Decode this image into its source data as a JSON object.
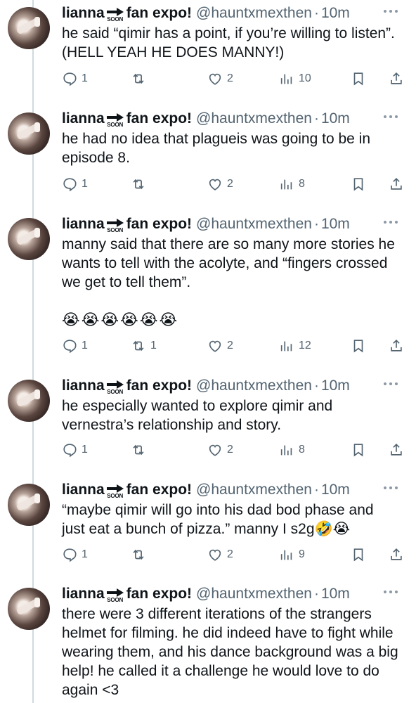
{
  "author": {
    "name": "lianna",
    "badge_text": "SOON",
    "display_suffix": "fan expo!",
    "handle": "@hauntxmexthen",
    "separator": "·",
    "time": "10m"
  },
  "tweets": [
    {
      "text": "he said “qimir has a point, if you’re willing to listen”. (HELL YEAH HE DOES MANNY!)",
      "emojis": "",
      "reply_count": "1",
      "retweet_count": "",
      "like_count": "2",
      "view_count": "10"
    },
    {
      "text": "he had no idea that plagueis was going to be in episode 8.",
      "emojis": "",
      "reply_count": "1",
      "retweet_count": "",
      "like_count": "2",
      "view_count": "8"
    },
    {
      "text": "manny said that there are so many more stories he wants to tell with the acolyte, and “fingers crossed we get to tell them”.",
      "emojis": "😭😭😭😭😭😭",
      "reply_count": "1",
      "retweet_count": "1",
      "like_count": "2",
      "view_count": "12"
    },
    {
      "text": "he especially wanted to explore qimir and vernestra’s relationship and story.",
      "emojis": "",
      "reply_count": "1",
      "retweet_count": "",
      "like_count": "2",
      "view_count": "8"
    },
    {
      "text": "“maybe qimir will go into his dad bod phase and just eat a bunch of pizza.” manny I s2g🤣😭",
      "emojis": "",
      "reply_count": "1",
      "retweet_count": "",
      "like_count": "2",
      "view_count": "9"
    },
    {
      "text": "there were 3 different iterations of the strangers helmet for filming. he did indeed have to fight while wearing them, and his dance background was a big help! he called it a challenge he would love to do again <3",
      "emojis": "",
      "reply_count": "",
      "retweet_count": "",
      "like_count": "",
      "view_count": ""
    }
  ],
  "icons": {
    "reply": "reply-icon",
    "retweet": "retweet-icon",
    "like": "heart-icon",
    "views": "views-icon",
    "bookmark": "bookmark-icon",
    "share": "share-icon",
    "more": "more-icon"
  },
  "colors": {
    "text": "#0f1419",
    "secondary": "#536471",
    "thread_line": "#cfd9de"
  }
}
